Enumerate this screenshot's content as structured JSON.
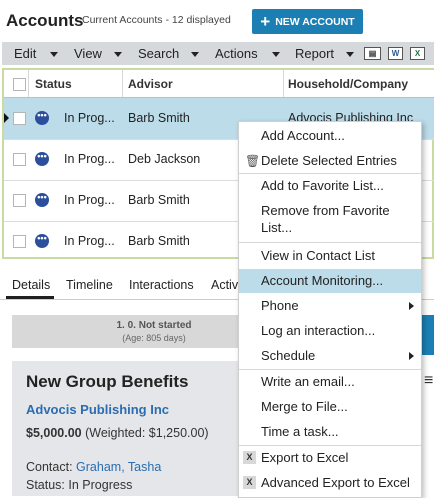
{
  "header": {
    "title": "Accounts",
    "subtitle": "Current Accounts - 12 displayed",
    "new_button": "NEW ACCOUNT"
  },
  "toolbar": {
    "edit": "Edit",
    "view": "View",
    "search": "Search",
    "actions": "Actions",
    "report": "Report",
    "icons": [
      "contact-card-icon",
      "word-icon",
      "excel-icon",
      "more-icon"
    ]
  },
  "grid": {
    "columns": [
      "Status",
      "Advisor",
      "Household/Company"
    ],
    "rows": [
      {
        "status": "In Prog...",
        "advisor": "Barb Smith",
        "company": "Advocis Publishing Inc"
      },
      {
        "status": "In Prog...",
        "advisor": "Deb Jackson",
        "company": ""
      },
      {
        "status": "In Prog...",
        "advisor": "Barb Smith",
        "company": ""
      },
      {
        "status": "In Prog...",
        "advisor": "Barb Smith",
        "company": ""
      }
    ]
  },
  "tabs": [
    "Details",
    "Timeline",
    "Interactions",
    "Activ"
  ],
  "stage": {
    "label": "1. 0. Not started",
    "age": "(Age: 805 days)"
  },
  "detail": {
    "title": "New Group Benefits",
    "company": "Advocis Publishing Inc",
    "amount": "$5,000.00",
    "weighted": "(Weighted: $1,250.00)",
    "contact_label": "Contact:",
    "contact_name": "Graham, Tasha",
    "status_label": "Status:",
    "status_value": "In Progress"
  },
  "context_menu": {
    "items": [
      "Add Account...",
      "Delete Selected Entries",
      "Add to Favorite List...",
      "Remove from Favorite",
      "List...",
      "View in Contact List",
      "Account Monitoring...",
      "Phone",
      "Log an interaction...",
      "Schedule",
      "Write an email...",
      "Merge to File...",
      "Time a task...",
      "Export to Excel",
      "Advanced Export to Excel"
    ],
    "highlighted": "Account Monitoring..."
  },
  "colors": {
    "accent": "#1c7fb3",
    "selected_row": "#bcdcea",
    "link": "#2a6db0",
    "toolbar_bg": "#d6d9dc"
  }
}
